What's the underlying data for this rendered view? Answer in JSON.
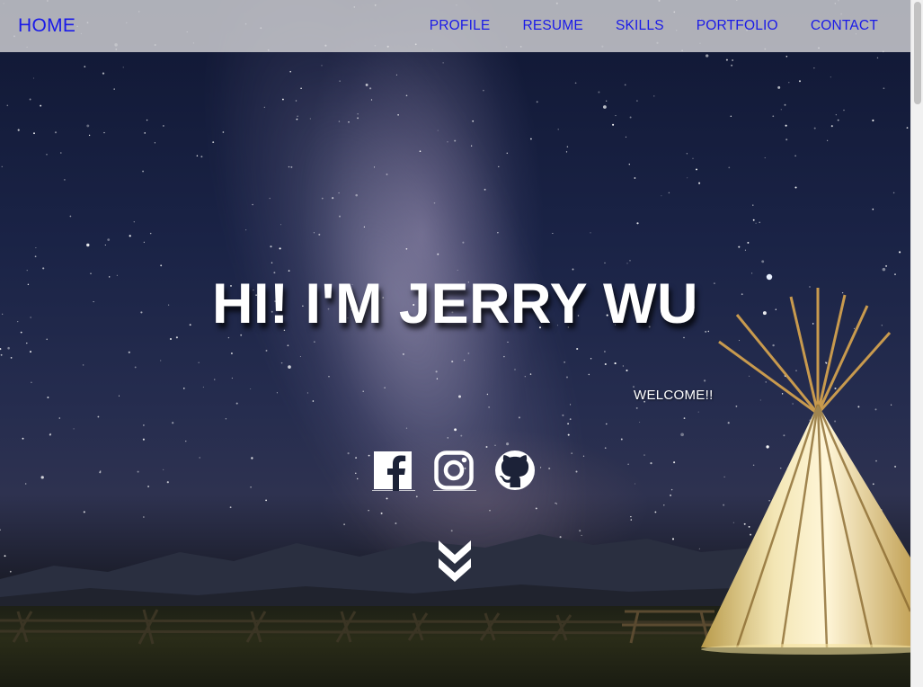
{
  "nav": {
    "home_label": "HOME",
    "links": [
      {
        "label": "PROFILE"
      },
      {
        "label": "RESUME"
      },
      {
        "label": "SKILLS"
      },
      {
        "label": "PORTFOLIO"
      },
      {
        "label": "CONTACT"
      }
    ],
    "link_color": "#1a1ae8"
  },
  "hero": {
    "title": "HI! I'M JERRY WU",
    "subtitle": "WELCOME!!",
    "background": "night sky with milky way and lit tipi"
  },
  "social": [
    {
      "icon": "facebook-icon"
    },
    {
      "icon": "instagram-icon"
    },
    {
      "icon": "github-icon"
    }
  ],
  "scroll_icon": "double-chevron-down-icon"
}
